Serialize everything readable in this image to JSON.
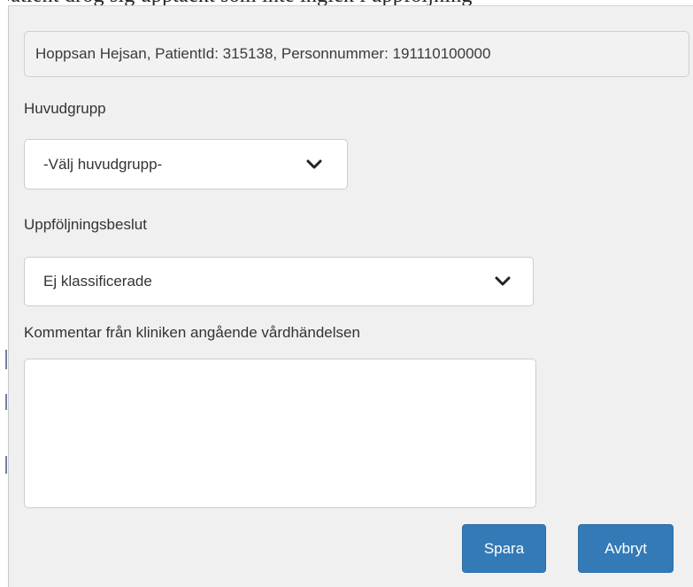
{
  "background_text": "patient drog sig upptäckt som inte ingick i uppföljning",
  "patient": {
    "info": "Hoppsan Hejsan, PatientId: 315138, Personnummer: 191110100000"
  },
  "huvudgrupp": {
    "label": "Huvudgrupp",
    "selected": "-Välj huvudgrupp-"
  },
  "uppfoljningsbeslut": {
    "label": "Uppföljningsbeslut",
    "selected": "Ej klassificerade"
  },
  "kommentar": {
    "label": "Kommentar från kliniken angående vårdhändelsen",
    "value": ""
  },
  "actions": {
    "save_label": "Spara",
    "cancel_label": "Avbryt"
  },
  "colors": {
    "primary": "#337ab7",
    "dialog_bg": "#f0f0f0",
    "input_border": "#cccccc"
  }
}
